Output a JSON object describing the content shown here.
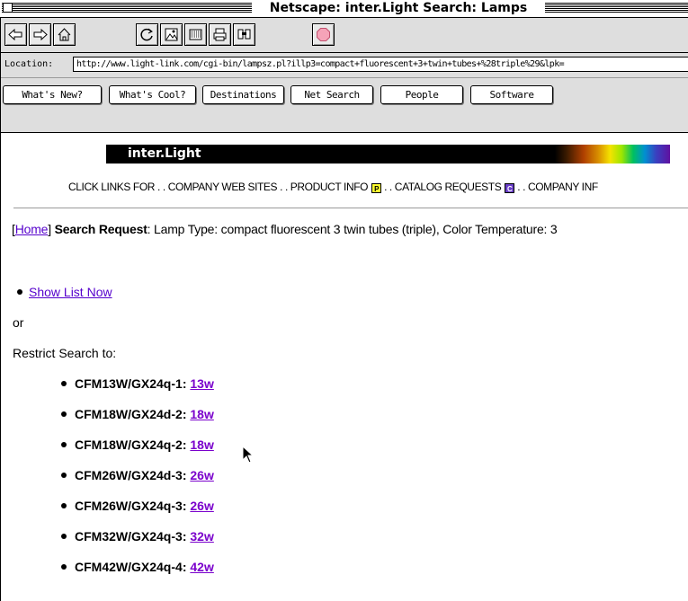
{
  "window": {
    "title": "Netscape: inter.Light Search: Lamps"
  },
  "toolbar": {
    "buttons": [
      {
        "name": "back-arrow-icon"
      },
      {
        "name": "forward-arrow-icon"
      },
      {
        "name": "home-icon"
      },
      {
        "name": "reload-icon"
      },
      {
        "name": "images-icon"
      },
      {
        "name": "open-icon"
      },
      {
        "name": "print-icon"
      },
      {
        "name": "find-icon"
      },
      {
        "name": "stop-icon"
      }
    ]
  },
  "location": {
    "label": "Location:",
    "url": "http://www.light-link.com/cgi-bin/lampsz.pl?illp3=compact+fluorescent+3+twin+tubes+%28triple%29&lpk="
  },
  "directory": {
    "buttons": [
      "What's New?",
      "What's Cool?",
      "Destinations",
      "Net Search",
      "People",
      "Software"
    ]
  },
  "page": {
    "brand": "inter.Light",
    "click_prefix": "CLICK LINKS FOR . . COMPANY WEB SITES . . PRODUCT INFO",
    "click_mid": ". . CATALOG REQUESTS",
    "click_suffix": ". . COMPANY INF",
    "badge_p": "P",
    "badge_c": "C",
    "home_link": "Home",
    "search_label": "Search Request",
    "search_text": ": Lamp Type: compact fluorescent 3 twin tubes (triple), Color Temperature: 3",
    "show_list": "Show List Now",
    "or_text": "or",
    "restrict_text": "Restrict Search to:",
    "lamps": [
      {
        "code": "CFM13W/GX24q-1",
        "watt": "13w"
      },
      {
        "code": "CFM18W/GX24d-2",
        "watt": "18w"
      },
      {
        "code": "CFM18W/GX24q-2",
        "watt": "18w"
      },
      {
        "code": "CFM26W/GX24d-3",
        "watt": "26w"
      },
      {
        "code": "CFM26W/GX24q-3",
        "watt": "26w"
      },
      {
        "code": "CFM32W/GX24q-3",
        "watt": "32w"
      },
      {
        "code": "CFM42W/GX24q-4",
        "watt": "42w"
      }
    ]
  },
  "colors": {
    "link": "#5500cc",
    "visited_link": "#7a00cc",
    "chrome_bg": "#dedede"
  }
}
